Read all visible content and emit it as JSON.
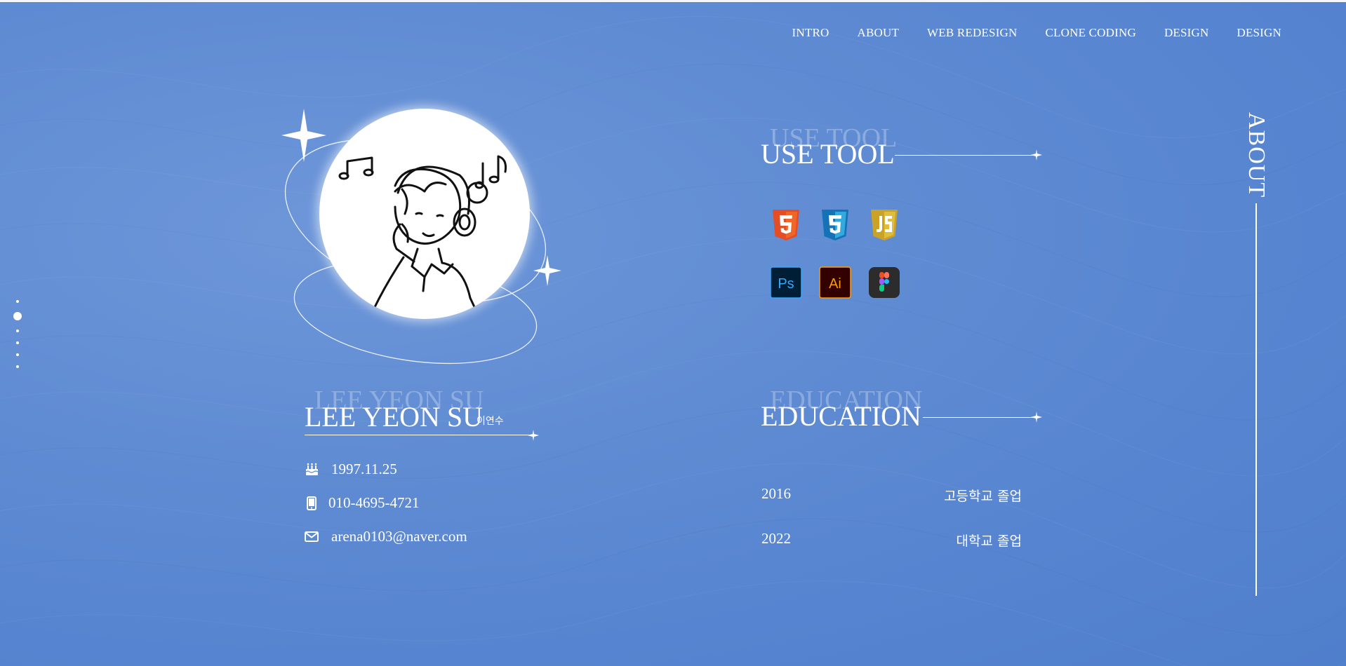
{
  "nav": {
    "items": [
      "INTRO",
      "ABOUT",
      "WEB REDESIGN",
      "CLONE CODING",
      "DESIGN",
      "DESIGN"
    ]
  },
  "side_label": "ABOUT",
  "profile": {
    "name_ghost": "LEE YEON SU",
    "name": "LEE YEON SU",
    "name_korean": "이연수",
    "birthday": "1997.11.25",
    "phone": "010-4695-4721",
    "email": "arena0103@naver.com"
  },
  "tools": {
    "title_ghost": "USE TOOL",
    "title": "USE TOOL",
    "icons": [
      "html5-icon",
      "css3-icon",
      "javascript-icon",
      "photoshop-icon",
      "illustrator-icon",
      "figma-icon"
    ]
  },
  "education": {
    "title_ghost": "EDUCATION",
    "title": "EDUCATION",
    "items": [
      {
        "year": "2016",
        "desc": "고등학교 졸업"
      },
      {
        "year": "2022",
        "desc": "대학교 졸업"
      }
    ]
  },
  "colors": {
    "background": "#5f8bd3",
    "html5": "#e44d26",
    "css3": "#1572b6",
    "javascript": "#d9b52b",
    "photoshop_bg": "#001e36",
    "photoshop_fg": "#31a8ff",
    "illustrator_bg": "#330000",
    "illustrator_fg": "#ff9a00",
    "figma_bg": "#2c2c2c"
  }
}
